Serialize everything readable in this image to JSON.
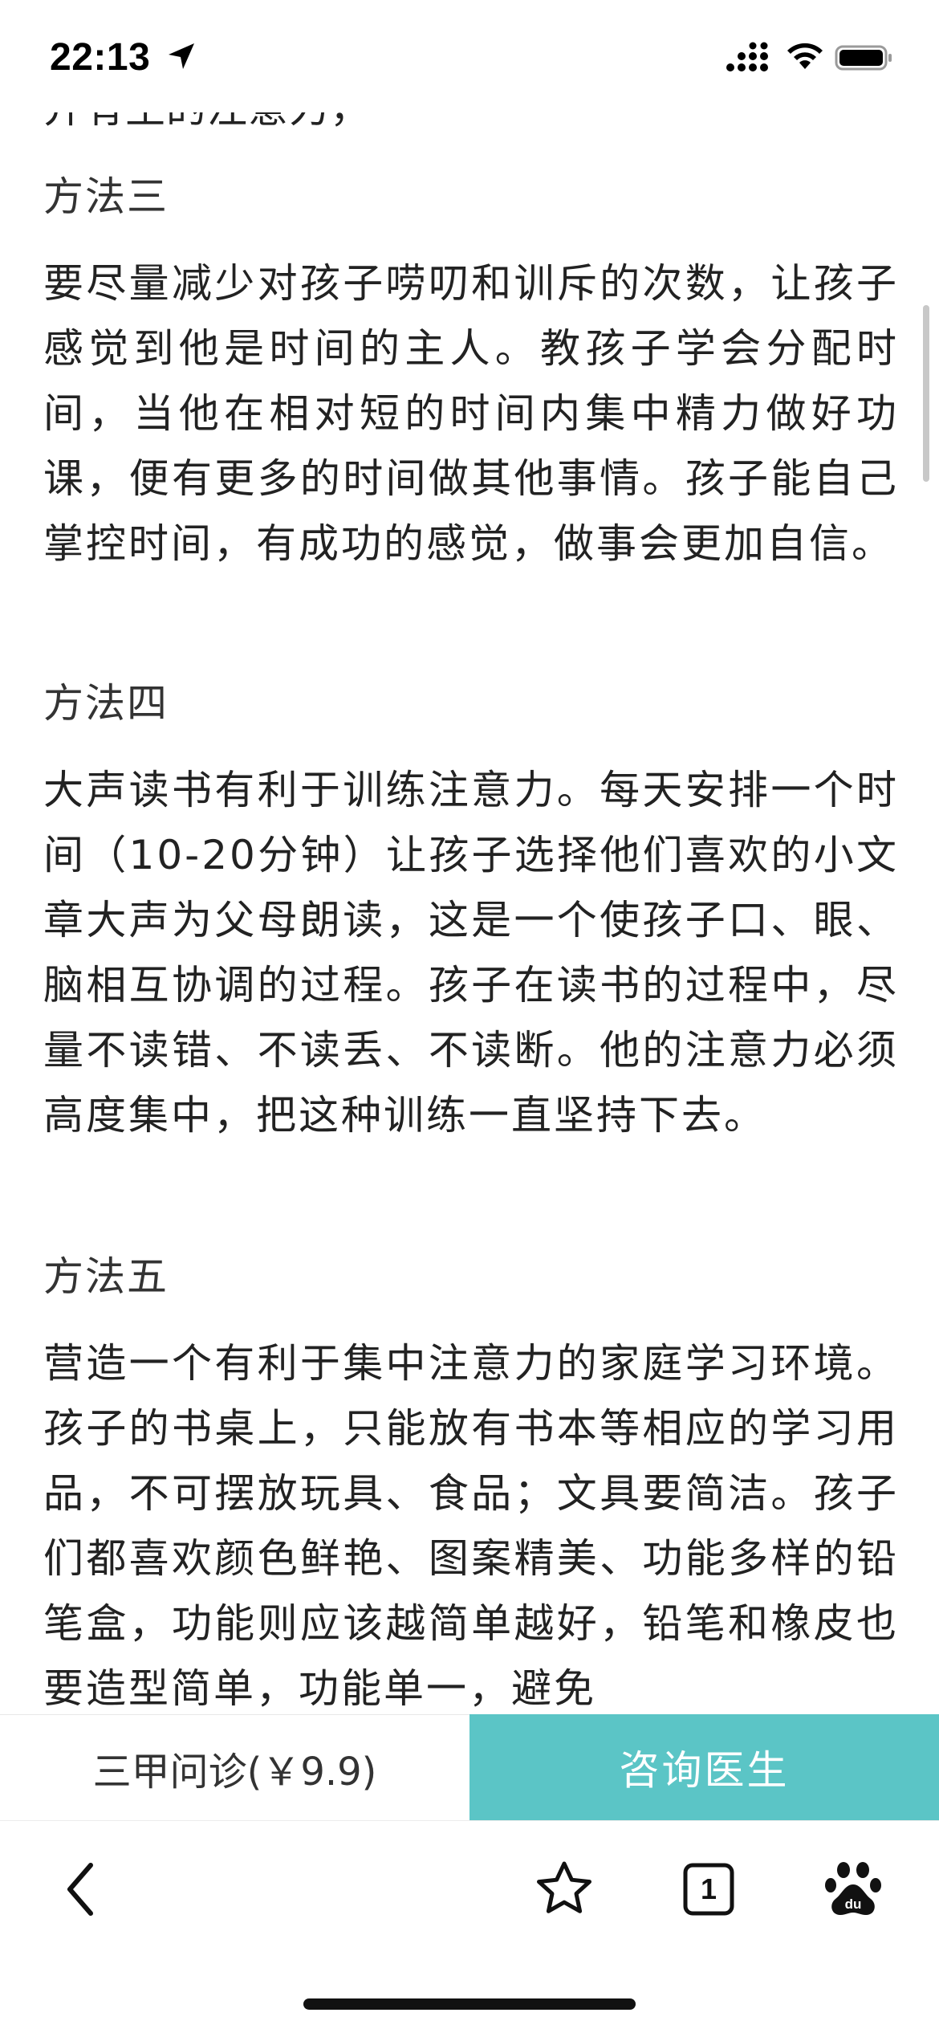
{
  "status_bar": {
    "time": "22:13"
  },
  "article": {
    "partial_top_line": "并有生的注意力，",
    "sections": [
      {
        "heading": "方法三",
        "text": "要尽量减少对孩子唠叨和训斥的次数，让孩子感觉到他是时间的主人。教孩子学会分配时间，当他在相对短的时间内集中精力做好功课，便有更多的时间做其他事情。孩子能自己掌控时间，有成功的感觉，做事会更加自信。"
      },
      {
        "heading": "方法四",
        "text": "大声读书有利于训练注意力。每天安排一个时间（10-20分钟）让孩子选择他们喜欢的小文章大声为父母朗读，这是一个使孩子口、眼、脑相互协调的过程。孩子在读书的过程中，尽量不读错、不读丢、不读断。他的注意力必须高度集中，把这种训练一直坚持下去。"
      },
      {
        "heading": "方法五",
        "text": "营造一个有利于集中注意力的家庭学习环境。孩子的书桌上，只能放有书本等相应的学习用品，不可摆放玩具、食品；文具要简洁。孩子们都喜欢颜色鲜艳、图案精美、功能多样的铅笔盒，功能则应该越简单越好，铅笔和橡皮也要造型简单，功能单一，避免"
      }
    ]
  },
  "consult_bar": {
    "price_label": "三甲问诊(￥9.9)",
    "doctor_label": "咨询医生",
    "accent_color": "#5bc5c6"
  },
  "toolbar": {
    "back_icon": "chevron-left",
    "favorite_icon": "star",
    "tabs_count": "1",
    "baidu_icon": "baidu-paw"
  }
}
